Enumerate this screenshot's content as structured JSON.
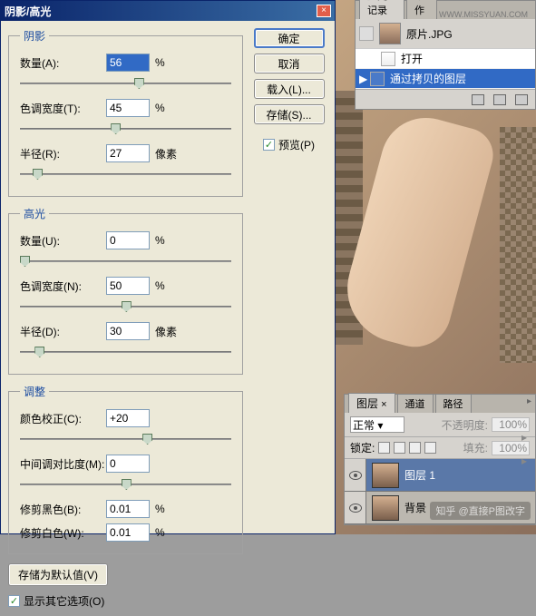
{
  "dialog": {
    "title": "阴影/高光",
    "shadows": {
      "legend": "阴影",
      "amount_label": "数量(A):",
      "amount_value": "56",
      "amount_unit": "%",
      "tonal_label": "色调宽度(T):",
      "tonal_value": "45",
      "tonal_unit": "%",
      "radius_label": "半径(R):",
      "radius_value": "27",
      "radius_unit": "像素"
    },
    "highlights": {
      "legend": "高光",
      "amount_label": "数量(U):",
      "amount_value": "0",
      "amount_unit": "%",
      "tonal_label": "色调宽度(N):",
      "tonal_value": "50",
      "tonal_unit": "%",
      "radius_label": "半径(D):",
      "radius_value": "30",
      "radius_unit": "像素"
    },
    "adjustments": {
      "legend": "调整",
      "color_label": "颜色校正(C):",
      "color_value": "+20",
      "midtone_label": "中间调对比度(M):",
      "midtone_value": "0",
      "black_label": "修剪黑色(B):",
      "black_value": "0.01",
      "black_unit": "%",
      "white_label": "修剪白色(W):",
      "white_value": "0.01",
      "white_unit": "%"
    },
    "save_default": "存储为默认值(V)",
    "show_more": "显示其它选项(O)",
    "buttons": {
      "ok": "确定",
      "cancel": "取消",
      "load": "载入(L)...",
      "save": "存储(S)..."
    },
    "preview": "预览(P)"
  },
  "history": {
    "tab1": "历史记录",
    "tab2": "动作",
    "url": "WWW.MISSYUAN.COM",
    "doc": "原片.JPG",
    "items": [
      "打开",
      "通过拷贝的图层"
    ]
  },
  "layers": {
    "tab1": "图层",
    "tab2": "通道",
    "tab3": "路径",
    "blend": "正常",
    "opacity_label": "不透明度:",
    "opacity": "100%",
    "lock_label": "锁定:",
    "fill_label": "填充:",
    "fill": "100%",
    "layer1": "图层 1",
    "bg": "背景"
  },
  "watermark": "知乎 @直接P图改字"
}
